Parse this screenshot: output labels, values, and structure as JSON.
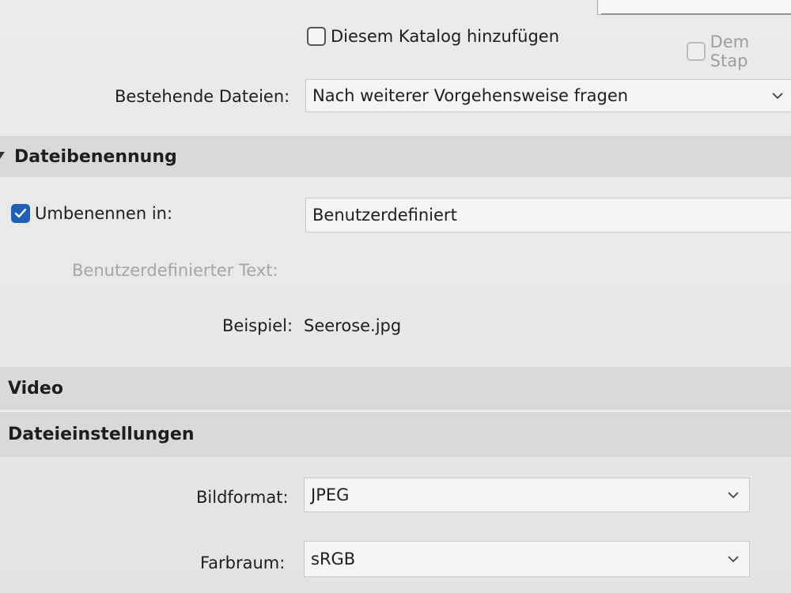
{
  "checkboxes": {
    "add_to_catalog": "Diesem Katalog hinzufügen",
    "add_to_stack": "Dem Stap",
    "rename_to": "Umbenennen in:"
  },
  "existing_files": {
    "label": "Bestehende Dateien:",
    "value": "Nach weiterer Vorgehensweise fragen"
  },
  "sections": {
    "file_naming": "Dateibenennung",
    "video": "Video",
    "file_settings": "Dateieinstellungen"
  },
  "naming": {
    "rename_value": "Benutzerdefiniert",
    "custom_text_label": "Benutzerdefinierter Text:",
    "example_label": "Beispiel:",
    "example_value": "Seerose.jpg"
  },
  "file_settings": {
    "image_format_label": "Bildformat:",
    "image_format_value": "JPEG",
    "color_space_label": "Farbraum:",
    "color_space_value": "sRGB"
  },
  "icons": {
    "dropdown": "chevron-down-icon",
    "section_toggle": "triangle-down-icon",
    "check": "checkmark-icon"
  }
}
